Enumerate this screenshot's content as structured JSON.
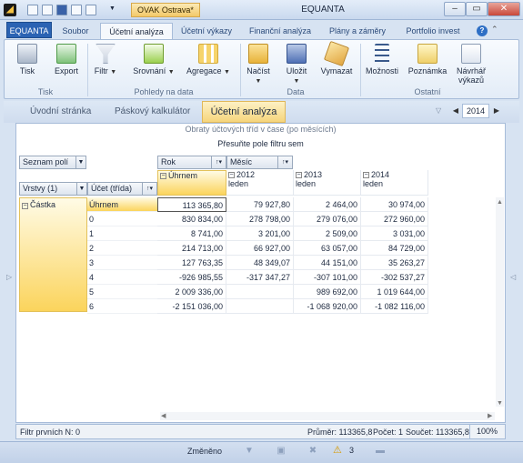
{
  "window": {
    "title": "EQUANTA",
    "document_tag": "OVAK Ostrava*",
    "minimize": "–",
    "restore": "▭",
    "close": "✕"
  },
  "quick_access": [
    "new",
    "open",
    "save",
    "print",
    "preview"
  ],
  "ribbon_tabs": {
    "file": "EQUANTA",
    "tabs": [
      "Soubor",
      "Účetní analýza",
      "Účetní výkazy",
      "Finanční analýza",
      "Plány a záměry",
      "Portfolio invest"
    ],
    "active_index": 1
  },
  "ribbon": {
    "buttons": {
      "tisk": "Tisk",
      "export": "Export",
      "filtr": "Filtr",
      "srovnani": "Srovnání",
      "agregace": "Agregace",
      "nacist": "Načíst",
      "ulozit": "Uložit",
      "vymazat": "Vymazat",
      "moznosti": "Možnosti",
      "poznamka": "Poznámka",
      "navrhar": "Návrhář výkazů"
    },
    "groups": {
      "tisk": "Tisk",
      "pohledy": "Pohledy na data",
      "data": "Data",
      "ostatni": "Ostatní"
    }
  },
  "nav": {
    "tabs": [
      "Úvodní stránka",
      "Páskový kalkulátor",
      "Účetní analýza"
    ],
    "active": "Účetní analýza",
    "year": "2014"
  },
  "pivot": {
    "title": "Obraty účtových tříd v čase (po měsících)",
    "filter_drop": "Přesuňte pole filtru sem",
    "field_list": "Seznam polí",
    "column_fields": [
      "Rok",
      "Měsíc"
    ],
    "row_fields": [
      "Vrstvy (1)",
      "Účet (třída)"
    ],
    "data_field": "Částka",
    "grand_total_col": "Úhrnem",
    "year_cols": [
      {
        "year": "2012",
        "month": "leden"
      },
      {
        "year": "2013",
        "month": "leden"
      },
      {
        "year": "2014",
        "month": "leden"
      }
    ],
    "rows": [
      {
        "label": "Úhrnem",
        "total": "113 365,80",
        "y2012": "79 927,80",
        "y2013": "2 464,00",
        "y2014": "30 974,00"
      },
      {
        "label": "0",
        "total": "830 834,00",
        "y2012": "278 798,00",
        "y2013": "279 076,00",
        "y2014": "272 960,00"
      },
      {
        "label": "1",
        "total": "8 741,00",
        "y2012": "3 201,00",
        "y2013": "2 509,00",
        "y2014": "3 031,00"
      },
      {
        "label": "2",
        "total": "214 713,00",
        "y2012": "66 927,00",
        "y2013": "63 057,00",
        "y2014": "84 729,00"
      },
      {
        "label": "3",
        "total": "127 763,35",
        "y2012": "48 349,07",
        "y2013": "44 151,00",
        "y2014": "35 263,27"
      },
      {
        "label": "4",
        "total": "-926 985,55",
        "y2012": "-317 347,27",
        "y2013": "-307 101,00",
        "y2014": "-302 537,27"
      },
      {
        "label": "5",
        "total": "2 009 336,00",
        "y2012": "",
        "y2013": "989 692,00",
        "y2014": "1 019 644,00"
      },
      {
        "label": "6",
        "total": "-2 151 036,00",
        "y2012": "",
        "y2013": "-1 068 920,00",
        "y2014": "-1 082 116,00"
      }
    ]
  },
  "status": {
    "filter": "Filtr prvních N: 0",
    "avg": "Průměr: 113365,8",
    "count": "Počet: 1",
    "sum": "Součet: 113365,8",
    "zoom": "100%"
  },
  "bottom": {
    "changed": "Změněno",
    "warnings": "3"
  }
}
